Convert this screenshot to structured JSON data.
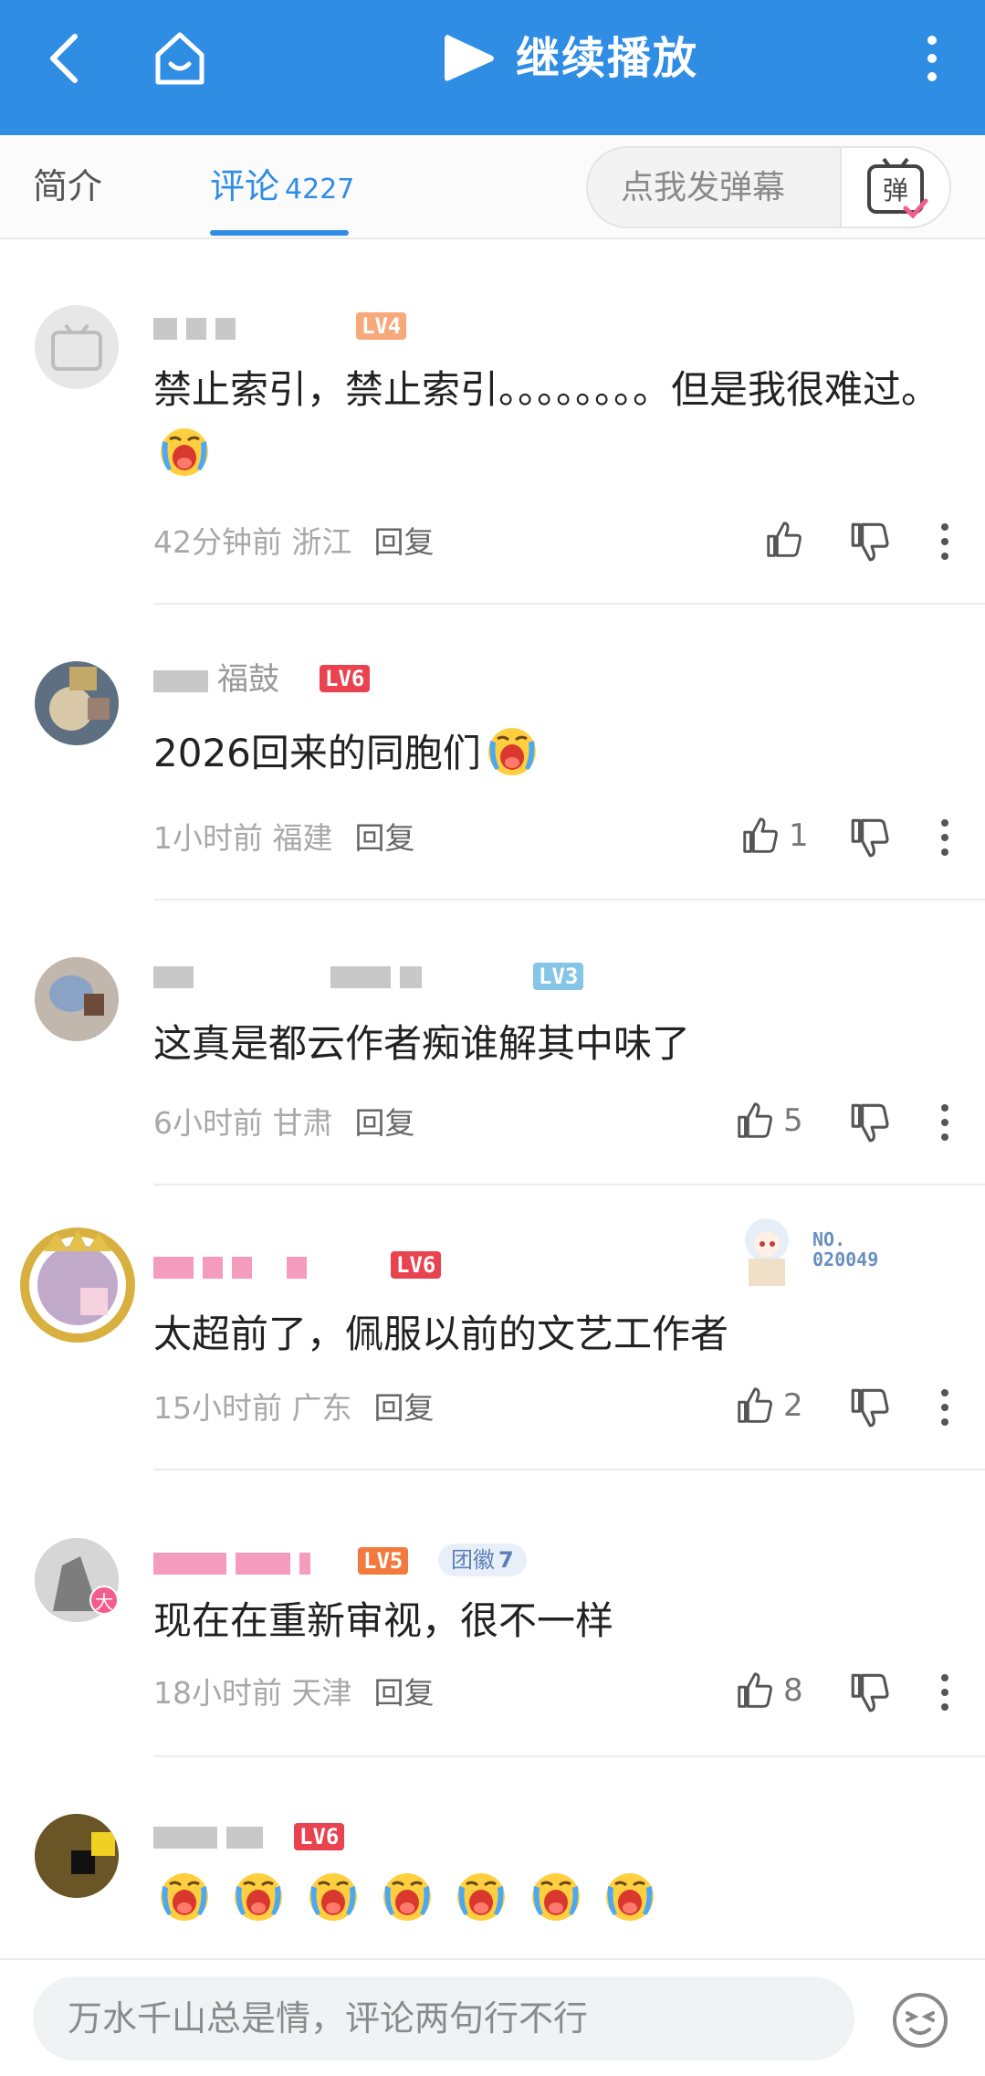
{
  "header": {
    "title": "继续播放",
    "colors": {
      "accent": "#2f8de4"
    }
  },
  "tabs": {
    "intro": "简介",
    "comments": "评论",
    "comments_count": "4227"
  },
  "danmaku": {
    "placeholder": "点我发弹幕",
    "button_label": "弹"
  },
  "comments": [
    {
      "level": "LV4",
      "level_color": "#f7a97b",
      "text": "禁止索引，禁止索引。。。。。。。。但是我很难过。",
      "time": "42分钟前",
      "location": "浙江",
      "reply": "回复",
      "likes": ""
    },
    {
      "name_visible": "福鼓",
      "level": "LV6",
      "level_color": "#e8434f",
      "text": "2026回来的同胞们",
      "time": "1小时前",
      "location": "福建",
      "reply": "回复",
      "likes": "1"
    },
    {
      "level": "LV3",
      "level_color": "#84c5e8",
      "text": "这真是都云作者痴谁解其中味了",
      "time": "6小时前",
      "location": "甘肃",
      "reply": "回复",
      "likes": "5"
    },
    {
      "level": "LV6",
      "level_color": "#e8434f",
      "badge_no": "NO.\n020049",
      "text": "太超前了，佩服以前的文艺工作者",
      "time": "15小时前",
      "location": "广东",
      "reply": "回复",
      "likes": "2"
    },
    {
      "level": "LV5",
      "level_color": "#f27a3e",
      "fan_badge": "团徽",
      "fan_badge_level": "7",
      "avatar_badge": "大",
      "text": "现在在重新审视，很不一样",
      "time": "18小时前",
      "location": "天津",
      "reply": "回复",
      "likes": "8"
    },
    {
      "level": "LV6",
      "level_color": "#e8434f",
      "text": ""
    }
  ],
  "bottom": {
    "input_placeholder": "万水千山总是情，评论两句行不行"
  }
}
